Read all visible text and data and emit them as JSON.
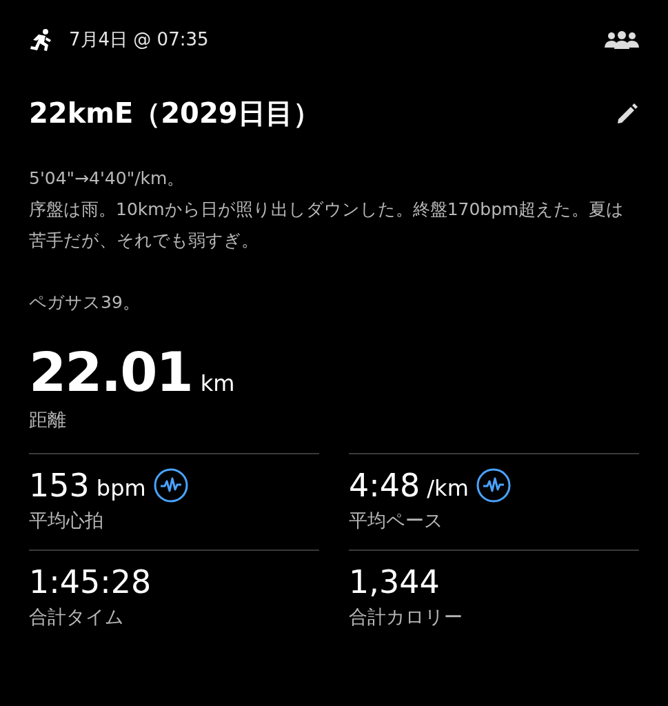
{
  "header": {
    "date": "7月4日 @ 07:35"
  },
  "title": "22kmE（2029日目）",
  "notes": [
    [
      "5'04\"→4'40\"/km。",
      "序盤は雨。10kmから日が照り出しダウンした。終盤170bpm超えた。夏は苦手だが、それでも弱すぎ。"
    ],
    [
      "ペガサス39。"
    ]
  ],
  "distance": {
    "value": "22.01",
    "unit": "km",
    "label": "距離"
  },
  "stats": [
    {
      "value": "153",
      "unit": "bpm",
      "label": "平均心拍",
      "chart_icon": true
    },
    {
      "value": "4:48",
      "unit": "/km",
      "label": "平均ペース",
      "chart_icon": true
    },
    {
      "value": "1:45:28",
      "label": "合計タイム",
      "chart_icon": false
    },
    {
      "value": "1,344",
      "label": "合計カロリー",
      "chart_icon": false
    }
  ]
}
